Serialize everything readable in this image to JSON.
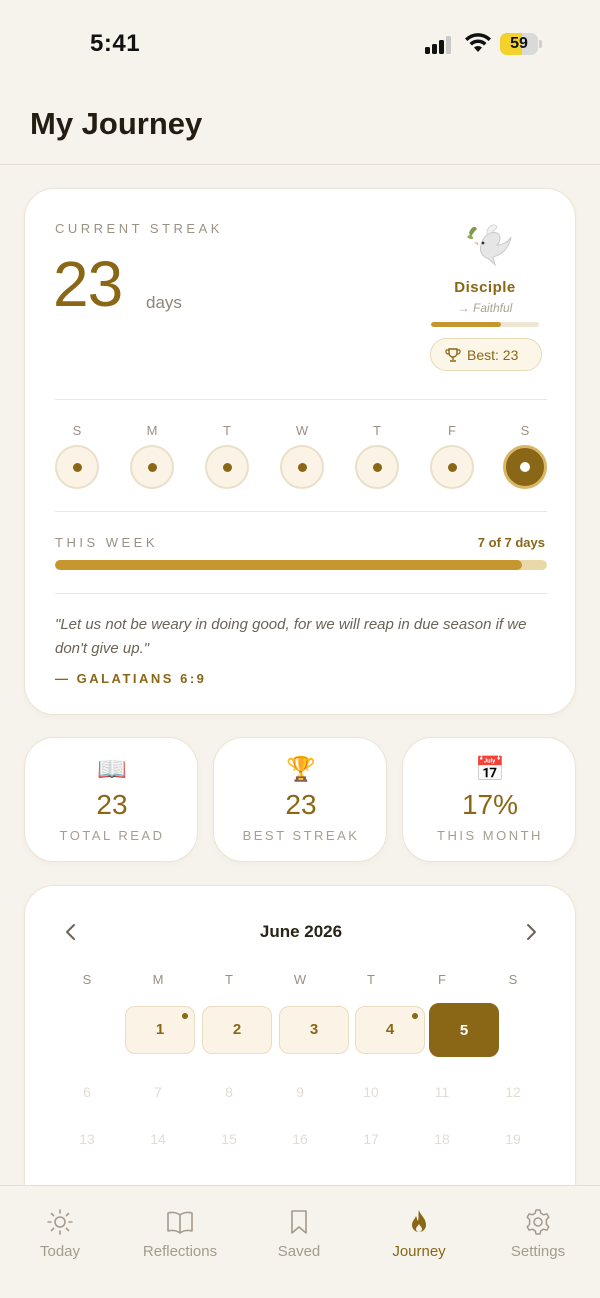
{
  "status_bar": {
    "time": "5:41",
    "battery": "59",
    "battery_level": 0.59
  },
  "header": {
    "title": "My Journey"
  },
  "streak": {
    "label": "CURRENT STREAK",
    "value": "23",
    "unit": "days",
    "rank": "Disciple",
    "next_rank": "→ Faithful",
    "rank_progress": 0.65,
    "best": "Best: 23",
    "days": [
      {
        "letter": "S",
        "done": true,
        "today": false
      },
      {
        "letter": "M",
        "done": true,
        "today": false
      },
      {
        "letter": "T",
        "done": true,
        "today": false
      },
      {
        "letter": "W",
        "done": true,
        "today": false
      },
      {
        "letter": "T",
        "done": true,
        "today": false
      },
      {
        "letter": "F",
        "done": true,
        "today": false
      },
      {
        "letter": "S",
        "done": true,
        "today": true
      }
    ],
    "week_label": "THIS WEEK",
    "week_count": "7 of 7 days",
    "week_progress": 0.95,
    "quote": "\"Let us not be weary in doing good, for we will reap in due season if we don't give up.\"",
    "quote_ref": "— GALATIANS 6:9"
  },
  "stats": [
    {
      "icon": "open-book-icon",
      "glyph": "📖",
      "value": "23",
      "label": "TOTAL READ"
    },
    {
      "icon": "trophy-icon",
      "glyph": "🏆",
      "value": "23",
      "label": "BEST STREAK"
    },
    {
      "icon": "calendar-icon",
      "glyph": "📅",
      "value": "17%",
      "label": "THIS MONTH"
    }
  ],
  "calendar": {
    "title": "June 2026",
    "weekdays": [
      "S",
      "M",
      "T",
      "W",
      "T",
      "F",
      "S"
    ],
    "active_days": [
      {
        "day": "1",
        "marked": true,
        "today": false
      },
      {
        "day": "2",
        "marked": false,
        "today": false
      },
      {
        "day": "3",
        "marked": false,
        "today": false
      },
      {
        "day": "4",
        "marked": true,
        "today": false
      },
      {
        "day": "5",
        "marked": false,
        "today": true
      }
    ],
    "future_rows": [
      [
        "6",
        "7",
        "8",
        "9",
        "10",
        "11",
        "12"
      ],
      [
        "13",
        "14",
        "15",
        "16",
        "17",
        "18",
        "19"
      ]
    ]
  },
  "tabs": [
    {
      "label": "Today",
      "icon": "sun-icon",
      "active": false
    },
    {
      "label": "Reflections",
      "icon": "book-icon",
      "active": false
    },
    {
      "label": "Saved",
      "icon": "bookmark-icon",
      "active": false
    },
    {
      "label": "Journey",
      "icon": "flame-icon",
      "active": true
    },
    {
      "label": "Settings",
      "icon": "gear-icon",
      "active": false
    }
  ],
  "colors": {
    "accent": "#8a6717",
    "gold": "#c7962e",
    "background": "#f6f3ed",
    "card": "#ffffff"
  }
}
